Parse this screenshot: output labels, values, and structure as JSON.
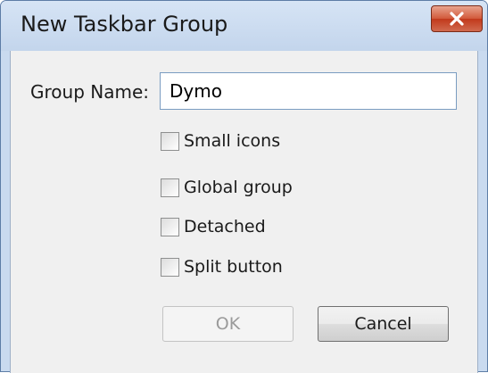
{
  "window": {
    "title": "New Taskbar Group"
  },
  "form": {
    "group_name_label": "Group Name:",
    "group_name_value": "Dymo",
    "checkboxes": [
      {
        "label": "Small icons",
        "checked": false
      },
      {
        "label": "Global group",
        "checked": false
      },
      {
        "label": "Detached",
        "checked": false
      },
      {
        "label": "Split button",
        "checked": false
      }
    ]
  },
  "buttons": {
    "ok_label": "OK",
    "ok_enabled": false,
    "cancel_label": "Cancel"
  },
  "icons": {
    "close": "close-icon"
  },
  "colors": {
    "titlebar": "#c9daef",
    "close_button": "#c7432a",
    "client_background": "#f0f0f0"
  }
}
